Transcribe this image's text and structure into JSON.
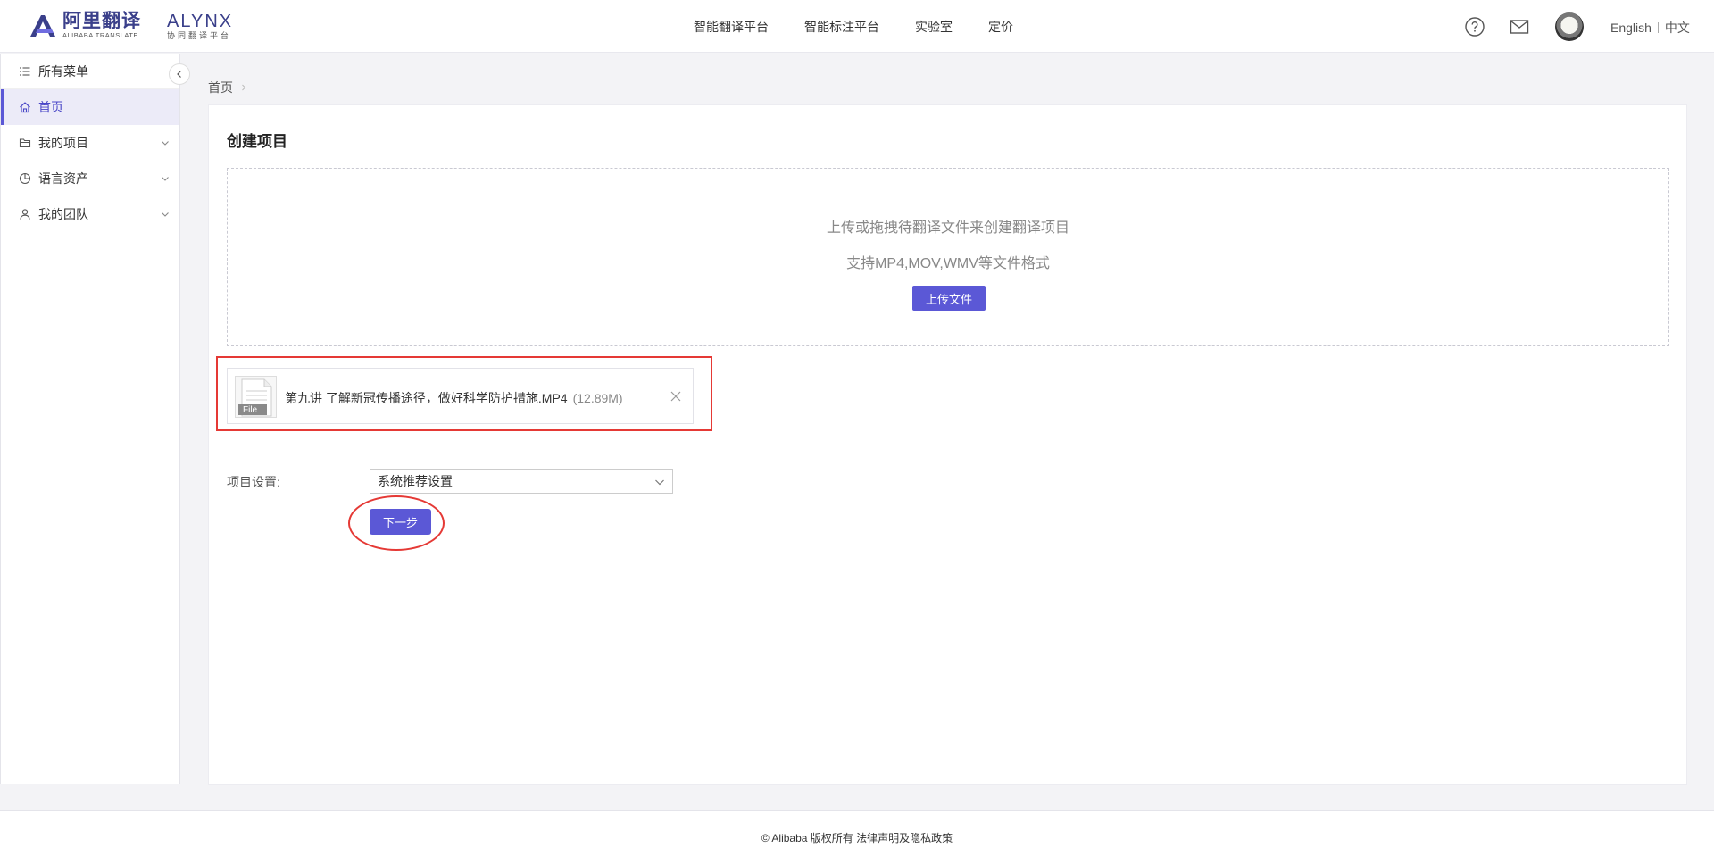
{
  "header": {
    "logo": {
      "cn_name": "阿里翻译",
      "en_name": "ALIBABA TRANSLATE",
      "alynx": "ALYNX",
      "alynx_sub": "协同翻译平台"
    },
    "nav": [
      {
        "label": "智能翻译平台"
      },
      {
        "label": "智能标注平台"
      },
      {
        "label": "实验室"
      },
      {
        "label": "定价"
      }
    ],
    "lang_en": "English",
    "lang_cn": "中文"
  },
  "sidebar": {
    "header_label": "所有菜单",
    "items": [
      {
        "label": "首页",
        "icon": "home-icon",
        "active": true
      },
      {
        "label": "我的项目",
        "icon": "folder-icon"
      },
      {
        "label": "语言资产",
        "icon": "pie-chart-icon"
      },
      {
        "label": "我的团队",
        "icon": "user-icon"
      }
    ]
  },
  "breadcrumb": {
    "home": "首页"
  },
  "main": {
    "title": "创建项目",
    "dropzone": {
      "line1": "上传或拖拽待翻译文件来创建翻译项目",
      "line2": "支持MP4,MOV,WMV等文件格式",
      "button": "上传文件"
    },
    "file": {
      "thumb_label": "File",
      "name": "第九讲 了解新冠传播途径，做好科学防护措施.MP4",
      "size": "(12.89M)"
    },
    "settings": {
      "label": "项目设置:",
      "selected": "系统推荐设置"
    },
    "next_button": "下一步"
  },
  "footer": {
    "text": "© Alibaba 版权所有 法律声明及隐私政策"
  },
  "colors": {
    "accent": "#5b58d6",
    "highlight_red": "#e53935",
    "brand_dark": "#3a3f8a"
  }
}
